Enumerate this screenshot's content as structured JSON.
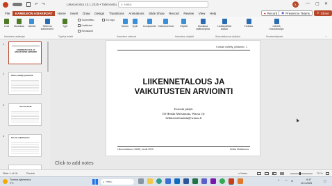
{
  "app": {
    "file_title": "Liiketoiminta 10.1.2025 • Tallennettu",
    "search_placeholder": "Haku",
    "user_initials": "JL"
  },
  "window_controls": {
    "minimize": "—",
    "maximize": "▢",
    "close": "✕"
  },
  "menu": {
    "items": [
      "File",
      "KAMELEON ASIAKIRJAT",
      "Home",
      "Insert",
      "Draw",
      "Design",
      "Transitions",
      "Animations",
      "Slide Show",
      "Record",
      "Review",
      "View",
      "Help"
    ]
  },
  "header_actions": {
    "record": "Record",
    "present_teams": "Present in Teams",
    "share": "Share"
  },
  "ribbon": {
    "buttons": {
      "uusi": "Uusi",
      "muokkaa": "Muokkaa",
      "laheta": "Lähetä",
      "tallenna": "Tallenna kohteeseen",
      "tyyli": "Tyyli",
      "muoto": "Muoto",
      "tyylikaspohjat": "Tyylit",
      "kuvapankki": "Kuvapankki",
      "diakokoelma": "Diakokoelmat",
      "objekti": "Objekti",
      "muokkaa_sel": "Muokkaa valittuohjeita",
      "lisaa_kaavio": "Lisää/päivitä kaavio",
      "tarkista": "Tarkista",
      "laheta_maaritys": "Lähetä muutosesitys"
    },
    "checks": {
      "suunnittelu": "Suunnittelu",
      "lisatiedot": "Lisätiedot",
      "revisio": "Revisiointi",
      "eu_logo": "EU logo"
    },
    "groups": {
      "asiakirjat": "Kameleon asiakirjat",
      "tyylit": "Tyylit ja tekstit",
      "kamera": "Kameleon valinnat",
      "objektit": "Kameleon objektit",
      "saavutettavuus": "Saavutettavuus työkalut",
      "hyvaksynta": "Muutosesitykset"
    }
  },
  "slides": {
    "numbers": [
      "1",
      "2",
      "3",
      "4"
    ],
    "thumb_titles": [
      "LIIKENNETALOUS JA VAIKUTUSTEN ARVIOINTI",
      "Talous, merkitys ja arviointi",
      "Kurssin tavoite",
      "Kurssin sisältö/luennot"
    ]
  },
  "slide": {
    "header_right": "Kurssin esittely, johdanto / 1",
    "title_line1": "LIIKENNETALOUS JA",
    "title_line2": "VAIKUTUSTEN ARVIOINTI",
    "sub1": "Kurssin pitäjä:",
    "sub2": "DI Heikki Metsäranta, Wassu Oy",
    "sub3": "heikki.metsaranta@wassu.fi",
    "footer_left": "Liikennetalous, HAMK, kevät 2025",
    "footer_right": "Heikki Metsäranta"
  },
  "notes": {
    "placeholder": "Click to add notes"
  },
  "status": {
    "slide_of": "Slide 1 of 18",
    "language": "Finnish",
    "notes": "Notes",
    "zoom": "75 %"
  },
  "taskbar": {
    "weather_temp": "Tumma kylmeneva",
    "weather_sub": "0°C",
    "time": "9.47",
    "date": "10.1.2025",
    "search": "Haku"
  }
}
